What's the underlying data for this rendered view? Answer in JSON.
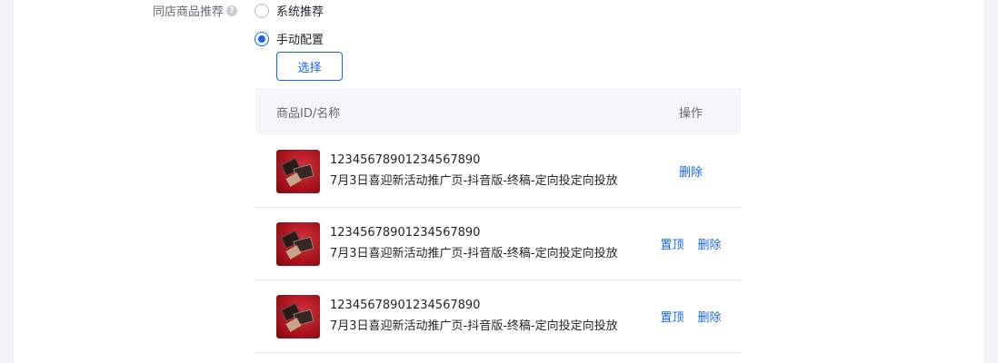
{
  "form": {
    "label": "同店商品推荐",
    "help_icon": "?",
    "options": [
      {
        "label": "系统推荐",
        "checked": false
      },
      {
        "label": "手动配置",
        "checked": true
      }
    ],
    "select_button": "选择"
  },
  "table": {
    "columns": {
      "name": "商品ID/名称",
      "ops": "操作"
    },
    "rows": [
      {
        "id": "12345678901234567890",
        "name": "7月3日喜迎新活动推广页-抖音版-终稿-定向投定向投放",
        "actions": [
          "删除"
        ]
      },
      {
        "id": "12345678901234567890",
        "name": "7月3日喜迎新活动推广页-抖音版-终稿-定向投定向投放",
        "actions": [
          "置顶",
          "删除"
        ]
      },
      {
        "id": "12345678901234567890",
        "name": "7月3日喜迎新活动推广页-抖音版-终稿-定向投定向投放",
        "actions": [
          "置顶",
          "删除"
        ]
      }
    ]
  },
  "colors": {
    "accent": "#1664ff",
    "header_bg": "#f5f6f7"
  }
}
